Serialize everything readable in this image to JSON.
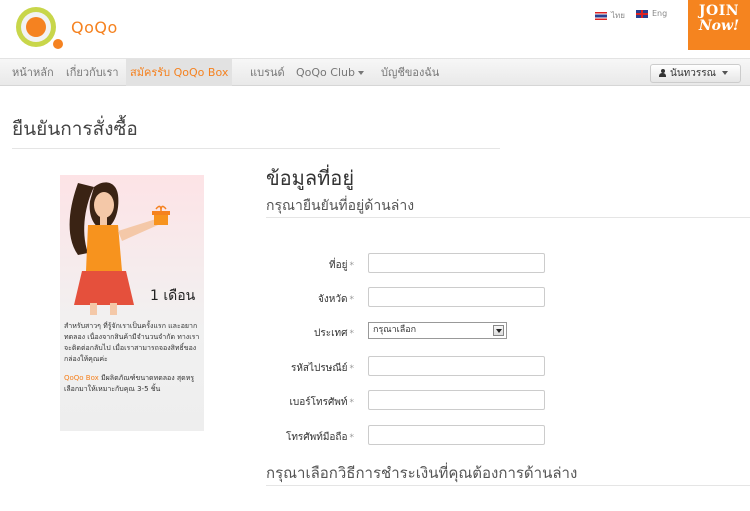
{
  "brand": {
    "name": "QoQo"
  },
  "languages": [
    {
      "label": "ไทย"
    },
    {
      "label": "Eng"
    }
  ],
  "join_badge": {
    "line1": "JOIN",
    "line2": "Now!"
  },
  "nav": {
    "items": [
      {
        "label": "หน้าหลัก"
      },
      {
        "label": "เกี่ยวกับเรา"
      },
      {
        "label": "สมัครรับ QoQo Box"
      },
      {
        "label": "แบรนด์"
      },
      {
        "label": "QoQo Club"
      },
      {
        "label": "บัญชีของฉัน"
      }
    ],
    "active_index": 2,
    "user_button": "นันทวรรณ"
  },
  "page": {
    "title": "ยืนยันการสั่งซื้อ"
  },
  "promo": {
    "month_label": "1 เดือน",
    "text": "สำหรับสาวๆ ที่รู้จักเราเป็นครั้งแรก และอยากทดลอง เนื่องจากสินค้ามีจำนวนจำกัด ทางเราจะติดต่อกลับไป เมื่อเราสามารถจองสิทธิ์ของกล่องให้คุณค่ะ",
    "brand_word": "QoQo Box",
    "text2": "มีผลิตภัณฑ์ขนาดทดลอง สุดหรูเลือกมาให้เหมาะกับคุณ 3-5 ชิ้น"
  },
  "address": {
    "heading": "ข้อมูลที่อยู่",
    "subheading": "กรุณายืนยันที่อยู่ด้านล่าง",
    "required_mark": "*",
    "fields": [
      {
        "label": "ที่อยู่",
        "value": ""
      },
      {
        "label": "จังหวัด",
        "value": ""
      },
      {
        "label": "ประเทศ",
        "value": "กรุณาเลือก"
      },
      {
        "label": "รหัสไปรษณีย์",
        "value": ""
      },
      {
        "label": "เบอร์โทรศัพท์",
        "value": ""
      },
      {
        "label": "โทรศัพท์มือถือ",
        "value": ""
      }
    ]
  },
  "payment": {
    "heading": "กรุณาเลือกวิธีการชำระเงินที่คุณต้องการด้านล่าง"
  },
  "colors": {
    "accent": "#f58220",
    "nav_bg": "#eeeeee",
    "text": "#333333"
  }
}
